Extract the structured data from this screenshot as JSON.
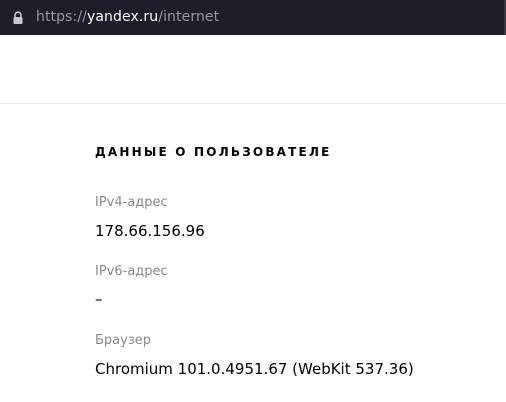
{
  "address_bar": {
    "url_scheme": "https://",
    "url_host": "yandex.ru",
    "url_path": "/internet",
    "lock_icon": "lock-icon"
  },
  "section": {
    "title": "ДАННЫЕ О ПОЛЬЗОВАТЕЛЕ"
  },
  "fields": [
    {
      "label": "IPv4-адрес",
      "value": "178.66.156.96"
    },
    {
      "label": "IPv6-адрес",
      "value": "–"
    },
    {
      "label": "Браузер",
      "value": "Chromium 101.0.4951.67 (WebKit 537.36)"
    }
  ]
}
